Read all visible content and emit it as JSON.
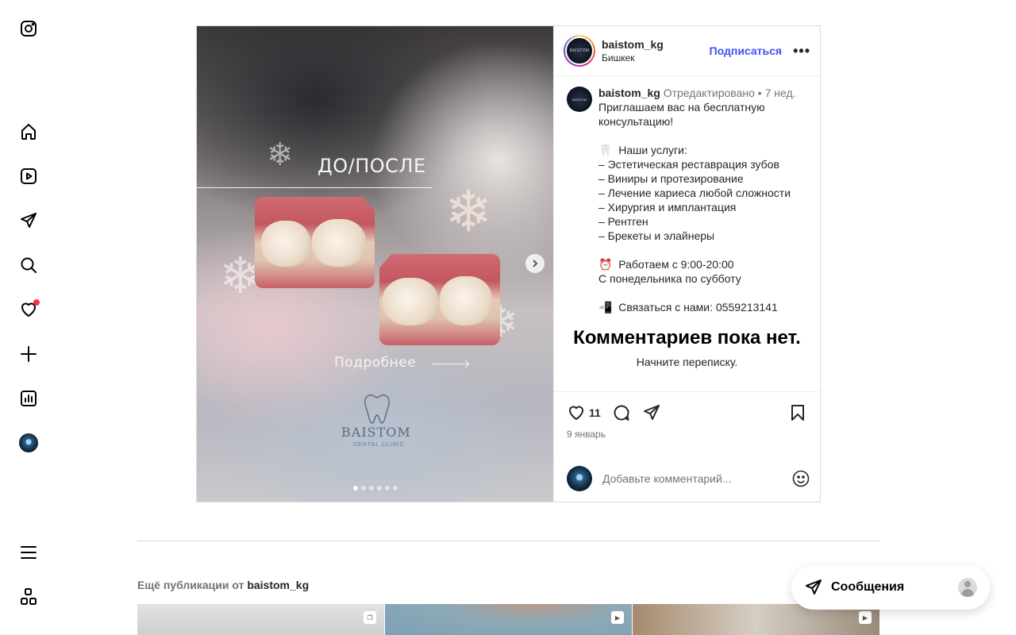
{
  "nav": {
    "items": [
      {
        "name": "instagram-logo-icon"
      },
      {
        "name": "home-icon"
      },
      {
        "name": "reels-icon"
      },
      {
        "name": "direct-icon"
      },
      {
        "name": "search-icon"
      },
      {
        "name": "heart-icon"
      },
      {
        "name": "plus-icon"
      },
      {
        "name": "dashboard-icon"
      },
      {
        "name": "profile-avatar"
      },
      {
        "name": "menu-icon"
      },
      {
        "name": "more-apps-icon"
      }
    ],
    "notification_dot_color": "#ff3040"
  },
  "media": {
    "title": "ДО/ПОСЛЕ",
    "more_link": "Подробнее",
    "logo_name": "BAISTOM",
    "logo_sub": "DENTAL CLINIC",
    "slide_count": 6,
    "active_slide": 1
  },
  "header": {
    "username": "baistom_kg",
    "location": "Бишкек",
    "follow_label": "Подписаться",
    "more_label": "•••",
    "avatar_text": "BAISTOM"
  },
  "caption": {
    "username": "baistom_kg",
    "edited": "Отредактировано",
    "separator": "•",
    "age": "7 нед.",
    "lines": [
      "Приглашаем вас на бесплатную",
      "консультацию!",
      "",
      "🦷  Наши услуги:",
      "– Эстетическая реставрация зубов",
      "– Виниры и протезирование",
      "– Лечение кариеса любой сложности",
      "– Хирургия и имплантация",
      "– Рентген",
      "– Брекеты и элайнеры",
      "",
      "⏰  Работаем с 9:00-20:00",
      "С понедельника по субботу",
      "",
      "📲  Связаться с нами: 0559213141"
    ]
  },
  "no_comments": {
    "title": "Комментариев пока нет.",
    "subtitle": "Начните переписку."
  },
  "actions": {
    "likes": "11",
    "date": "9 январь"
  },
  "comment": {
    "placeholder": "Добавьте комментарий..."
  },
  "more_posts": {
    "prefix": "Ещё публикации от",
    "username": "baistom_kg"
  },
  "messages": {
    "label": "Сообщения"
  },
  "colors": {
    "follow": "#4150f7",
    "text": "#262626",
    "muted": "#737373",
    "border": "#dbdbdb"
  }
}
